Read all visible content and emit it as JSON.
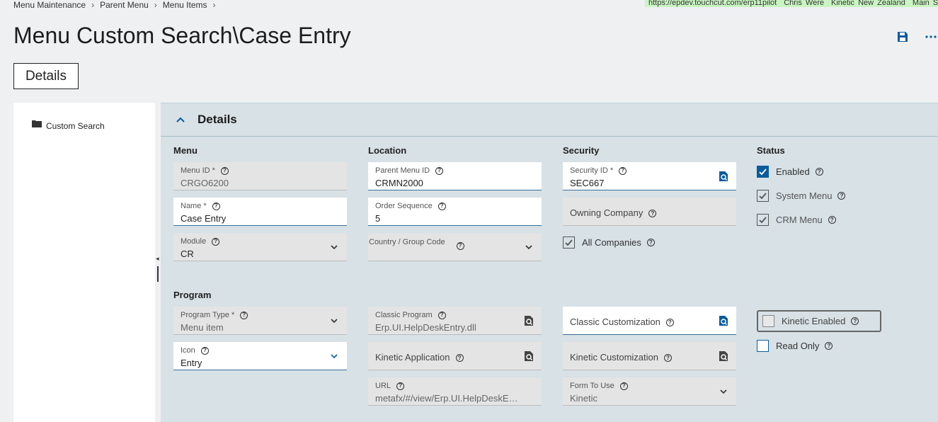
{
  "breadcrumb": [
    "Menu Maintenance",
    "Parent Menu",
    "Menu Items"
  ],
  "env_bar": [
    "https://epdev.touchcut.com/erp11pilot",
    "Chris Were",
    "Kinetic New Zealand",
    "Main S"
  ],
  "page_title": "Menu Custom Search\\Case Entry",
  "tab_label": "Details",
  "tree": {
    "item": "Custom Search"
  },
  "panel_title": "Details",
  "sections": {
    "menu": "Menu",
    "location": "Location",
    "security": "Security",
    "status": "Status",
    "program": "Program"
  },
  "fields": {
    "menu_id": {
      "label": "Menu ID *",
      "value": "CRGO6200"
    },
    "name": {
      "label": "Name *",
      "value": "Case Entry"
    },
    "module": {
      "label": "Module",
      "value": "CR"
    },
    "parent_menu_id": {
      "label": "Parent Menu ID",
      "value": "CRMN2000"
    },
    "order_sequence": {
      "label": "Order Sequence",
      "value": "5"
    },
    "country_group": {
      "label": "Country / Group Code",
      "value": ""
    },
    "security_id": {
      "label": "Security ID *",
      "value": "SEC667"
    },
    "owning_company": {
      "label": "Owning Company",
      "value": ""
    },
    "program_type": {
      "label": "Program Type *",
      "value": "Menu item"
    },
    "icon": {
      "label": "Icon",
      "value": "Entry"
    },
    "classic_program": {
      "label": "Classic Program",
      "value": "Erp.UI.HelpDeskEntry.dll"
    },
    "kinetic_application": {
      "label": "Kinetic Application",
      "value": ""
    },
    "url": {
      "label": "URL",
      "value": "metafx/#/view/Erp.UI.HelpDeskEnt…"
    },
    "classic_customization": {
      "label": "Classic Customization",
      "value": ""
    },
    "kinetic_customization": {
      "label": "Kinetic Customization",
      "value": ""
    },
    "form_to_use": {
      "label": "Form To Use",
      "value": "Kinetic"
    }
  },
  "checkboxes": {
    "all_companies": {
      "label": "All Companies",
      "checked": true
    },
    "enabled": {
      "label": "Enabled",
      "checked": true
    },
    "system_menu": {
      "label": "System Menu",
      "checked": true
    },
    "crm_menu": {
      "label": "CRM Menu",
      "checked": true
    },
    "kinetic_enabled": {
      "label": "Kinetic Enabled",
      "checked": false
    },
    "read_only": {
      "label": "Read Only",
      "checked": false
    }
  },
  "colors": {
    "accent": "#0a5b9e",
    "panel": "#d7e1e6",
    "env": "#c9f5c2"
  },
  "icons": [
    "folder-icon",
    "save-icon",
    "more-icon",
    "search-icon",
    "chevron-down-icon",
    "chevron-up-icon",
    "help-icon"
  ]
}
